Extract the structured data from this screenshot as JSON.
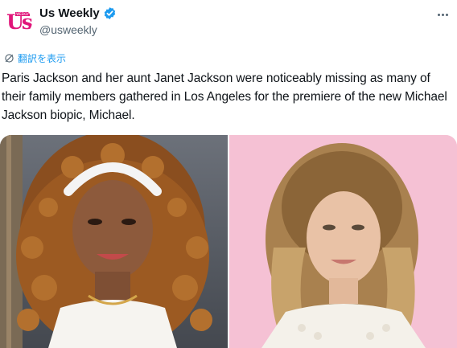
{
  "account": {
    "display_name": "Us Weekly",
    "handle": "@usweekly",
    "avatar_logo": "Us",
    "avatar_tag": "WEEKLY",
    "verified": true,
    "verified_icon": "verified-badge-icon"
  },
  "translate_label": "翻訳を表示",
  "tweet_text": "Paris Jackson and her aunt Janet Jackson were noticeably missing as many of their family members gathered in Los Angeles for the premiere of the new Michael Jackson biopic, Michael.",
  "media": [
    {
      "subject": "woman with curly auburn hair and white headband",
      "background": "#5a5f68"
    },
    {
      "subject": "woman with wavy blonde hair",
      "background": "#f2b8cf"
    }
  ],
  "colors": {
    "accent": "#1d9bf0",
    "brand_logo": "#e0167a",
    "text_primary": "#0f1419",
    "text_secondary": "#536471"
  }
}
